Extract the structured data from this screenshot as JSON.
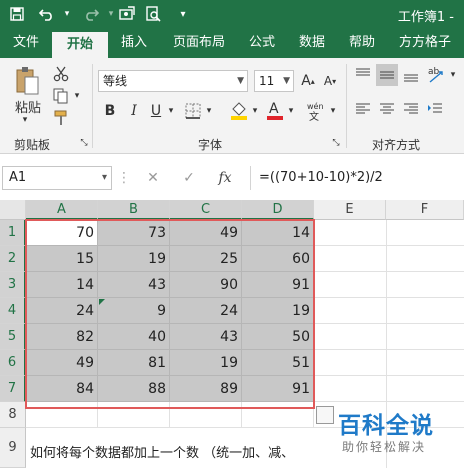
{
  "title_bar": {
    "doc_title": "工作簿1 -"
  },
  "tabs": [
    "文件",
    "开始",
    "插入",
    "页面布局",
    "公式",
    "数据",
    "帮助",
    "方方格子"
  ],
  "active_tab": "开始",
  "ribbon": {
    "clipboard": {
      "paste_label": "粘贴",
      "group_label": "剪贴板"
    },
    "font": {
      "font_name": "等线",
      "font_size": "11",
      "bold": "B",
      "italic": "I",
      "underline": "U",
      "group_label": "字体"
    },
    "alignment": {
      "group_label": "对齐方式"
    }
  },
  "formula_bar": {
    "name_box": "A1",
    "fx": "fx",
    "formula": "=((70+10-10)*2)/2"
  },
  "sheet": {
    "columns": [
      "A",
      "B",
      "C",
      "D",
      "E",
      "F"
    ],
    "rows": [
      "1",
      "2",
      "3",
      "4",
      "5",
      "6",
      "7",
      "8",
      "9"
    ],
    "data": [
      [
        "70",
        "73",
        "49",
        "14"
      ],
      [
        "15",
        "19",
        "25",
        "60"
      ],
      [
        "14",
        "43",
        "90",
        "91"
      ],
      [
        "24",
        "9",
        "24",
        "19"
      ],
      [
        "82",
        "40",
        "43",
        "50"
      ],
      [
        "49",
        "81",
        "19",
        "51"
      ],
      [
        "84",
        "88",
        "89",
        "91"
      ]
    ],
    "note": "如何将每个数据都加上一个数 （统一加、减、"
  },
  "watermark": {
    "main": "百科全说",
    "sub": "助你轻松解决"
  },
  "colors": {
    "excel_green": "#217346",
    "selection_red": "#e05a5a",
    "watermark_blue": "#1f7ac8"
  }
}
